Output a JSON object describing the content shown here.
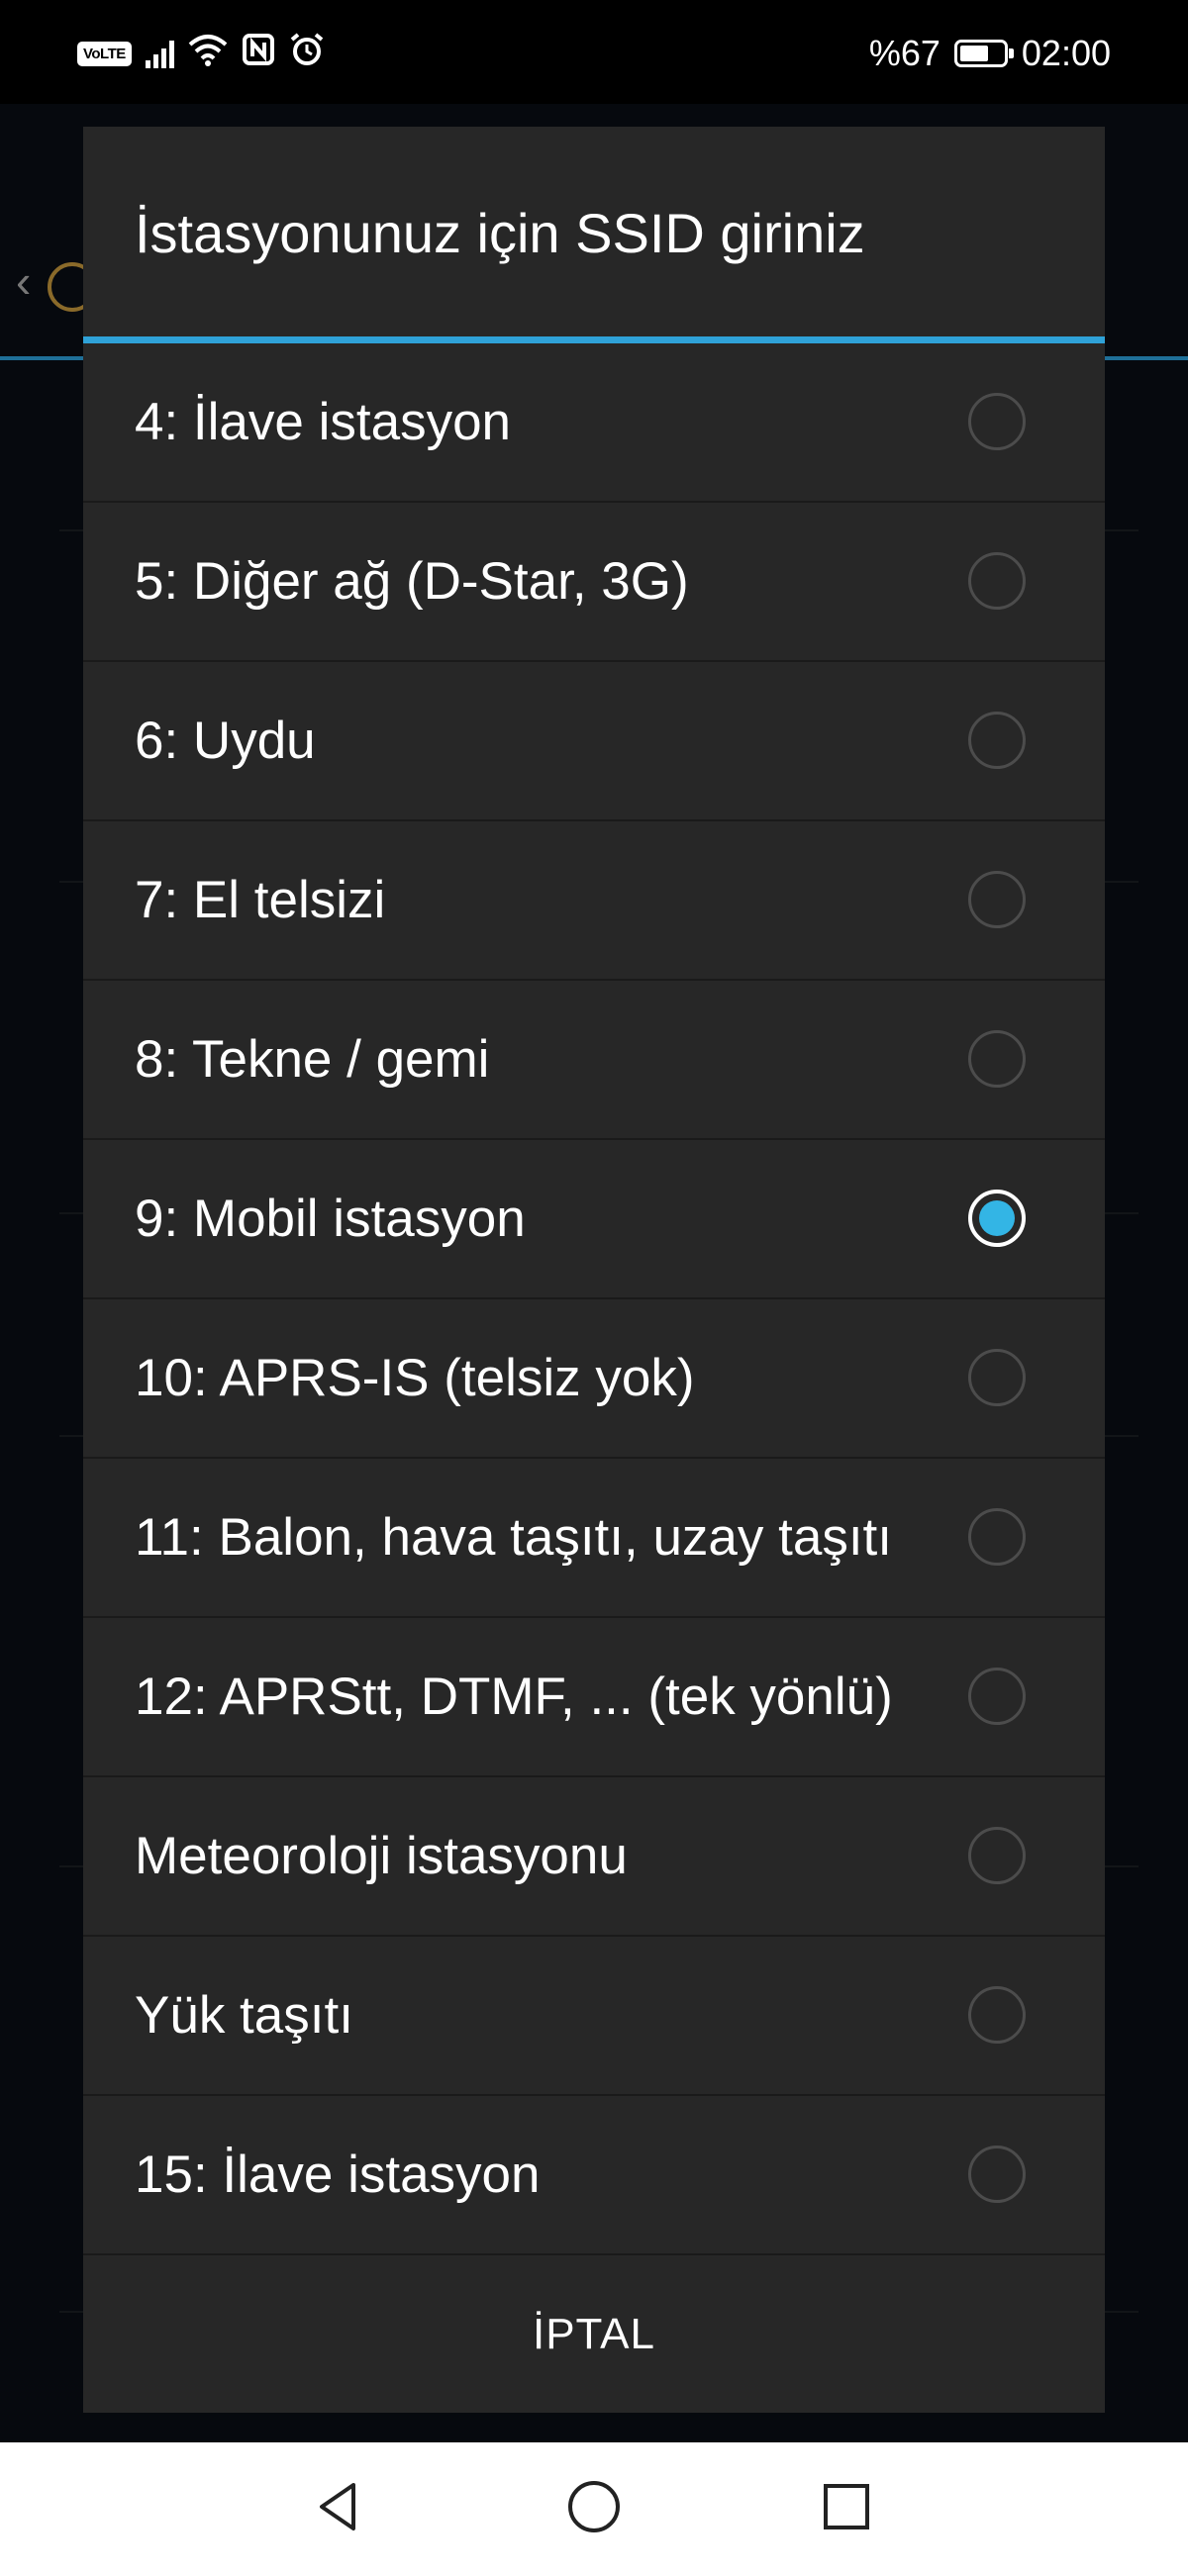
{
  "status_bar": {
    "volte": "VoLTE",
    "battery_text": "%67",
    "battery_level_percent": 67,
    "time": "02:00",
    "icons": [
      "signal-icon",
      "wifi-icon",
      "nfc-icon",
      "alarm-icon",
      "battery-icon"
    ]
  },
  "dialog": {
    "title": "İstasyonunuz için SSID giriniz",
    "options": [
      {
        "label": "4: İlave istasyon",
        "selected": false
      },
      {
        "label": "5: Diğer ağ (D-Star, 3G)",
        "selected": false
      },
      {
        "label": "6: Uydu",
        "selected": false
      },
      {
        "label": "7: El telsizi",
        "selected": false
      },
      {
        "label": "8: Tekne / gemi",
        "selected": false
      },
      {
        "label": "9: Mobil istasyon",
        "selected": true
      },
      {
        "label": "10: APRS-IS (telsiz yok)",
        "selected": false
      },
      {
        "label": "11: Balon, hava taşıtı, uzay taşıtı",
        "selected": false
      },
      {
        "label": "12: APRStt, DTMF, ... (tek yönlü)",
        "selected": false
      },
      {
        "label": "Meteoroloji istasyonu",
        "selected": false
      },
      {
        "label": "Yük taşıtı",
        "selected": false
      },
      {
        "label": "15: İlave istasyon",
        "selected": false
      }
    ],
    "cancel_label": "İPTAL"
  },
  "nav_bar": {
    "icons": [
      "back-icon",
      "home-icon",
      "recents-icon"
    ]
  },
  "colors": {
    "accent": "#2fa2d8",
    "radio_selected": "#33b5e5",
    "dialog_bg": "#272727"
  }
}
